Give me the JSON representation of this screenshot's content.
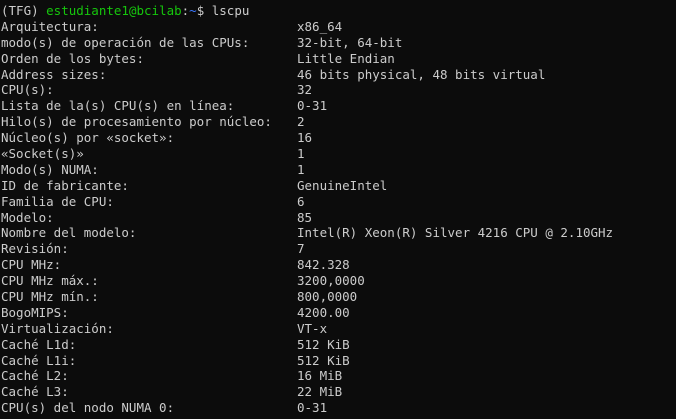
{
  "prompt": {
    "env": "(TFG) ",
    "user_host": "estudiante1@bcilab",
    "colon": ":",
    "path": "~",
    "symbol": "$ ",
    "command": "lscpu"
  },
  "rows": [
    {
      "key": "Arquitectura:",
      "value": "x86_64"
    },
    {
      "key": "modo(s) de operación de las CPUs:",
      "value": "32-bit, 64-bit"
    },
    {
      "key": "Orden de los bytes:",
      "value": "Little Endian"
    },
    {
      "key": "Address sizes:",
      "value": "46 bits physical, 48 bits virtual"
    },
    {
      "key": "CPU(s):",
      "value": "32"
    },
    {
      "key": "Lista de la(s) CPU(s) en línea:",
      "value": "0-31"
    },
    {
      "key": "Hilo(s) de procesamiento por núcleo:",
      "value": "2"
    },
    {
      "key": "Núcleo(s) por «socket»:",
      "value": "16"
    },
    {
      "key": "«Socket(s)»",
      "value": "1"
    },
    {
      "key": "Modo(s) NUMA:",
      "value": "1"
    },
    {
      "key": "ID de fabricante:",
      "value": "GenuineIntel"
    },
    {
      "key": "Familia de CPU:",
      "value": "6"
    },
    {
      "key": "Modelo:",
      "value": "85"
    },
    {
      "key": "Nombre del modelo:",
      "value": "Intel(R) Xeon(R) Silver 4216 CPU @ 2.10GHz"
    },
    {
      "key": "Revisión:",
      "value": "7"
    },
    {
      "key": "CPU MHz:",
      "value": "842.328"
    },
    {
      "key": "CPU MHz máx.:",
      "value": "3200,0000"
    },
    {
      "key": "CPU MHz mín.:",
      "value": "800,0000"
    },
    {
      "key": "BogoMIPS:",
      "value": "4200.00"
    },
    {
      "key": "Virtualización:",
      "value": "VT-x"
    },
    {
      "key": "Caché L1d:",
      "value": "512 KiB"
    },
    {
      "key": "Caché L1i:",
      "value": "512 KiB"
    },
    {
      "key": "Caché L2:",
      "value": "16 MiB"
    },
    {
      "key": "Caché L3:",
      "value": "22 MiB"
    },
    {
      "key": "CPU(s) del nodo NUMA 0:",
      "value": "0-31"
    }
  ],
  "colors": {
    "background": "#0c0c0c",
    "text": "#cccccc",
    "user_host": "#16c60c",
    "path": "#3b78ff"
  }
}
